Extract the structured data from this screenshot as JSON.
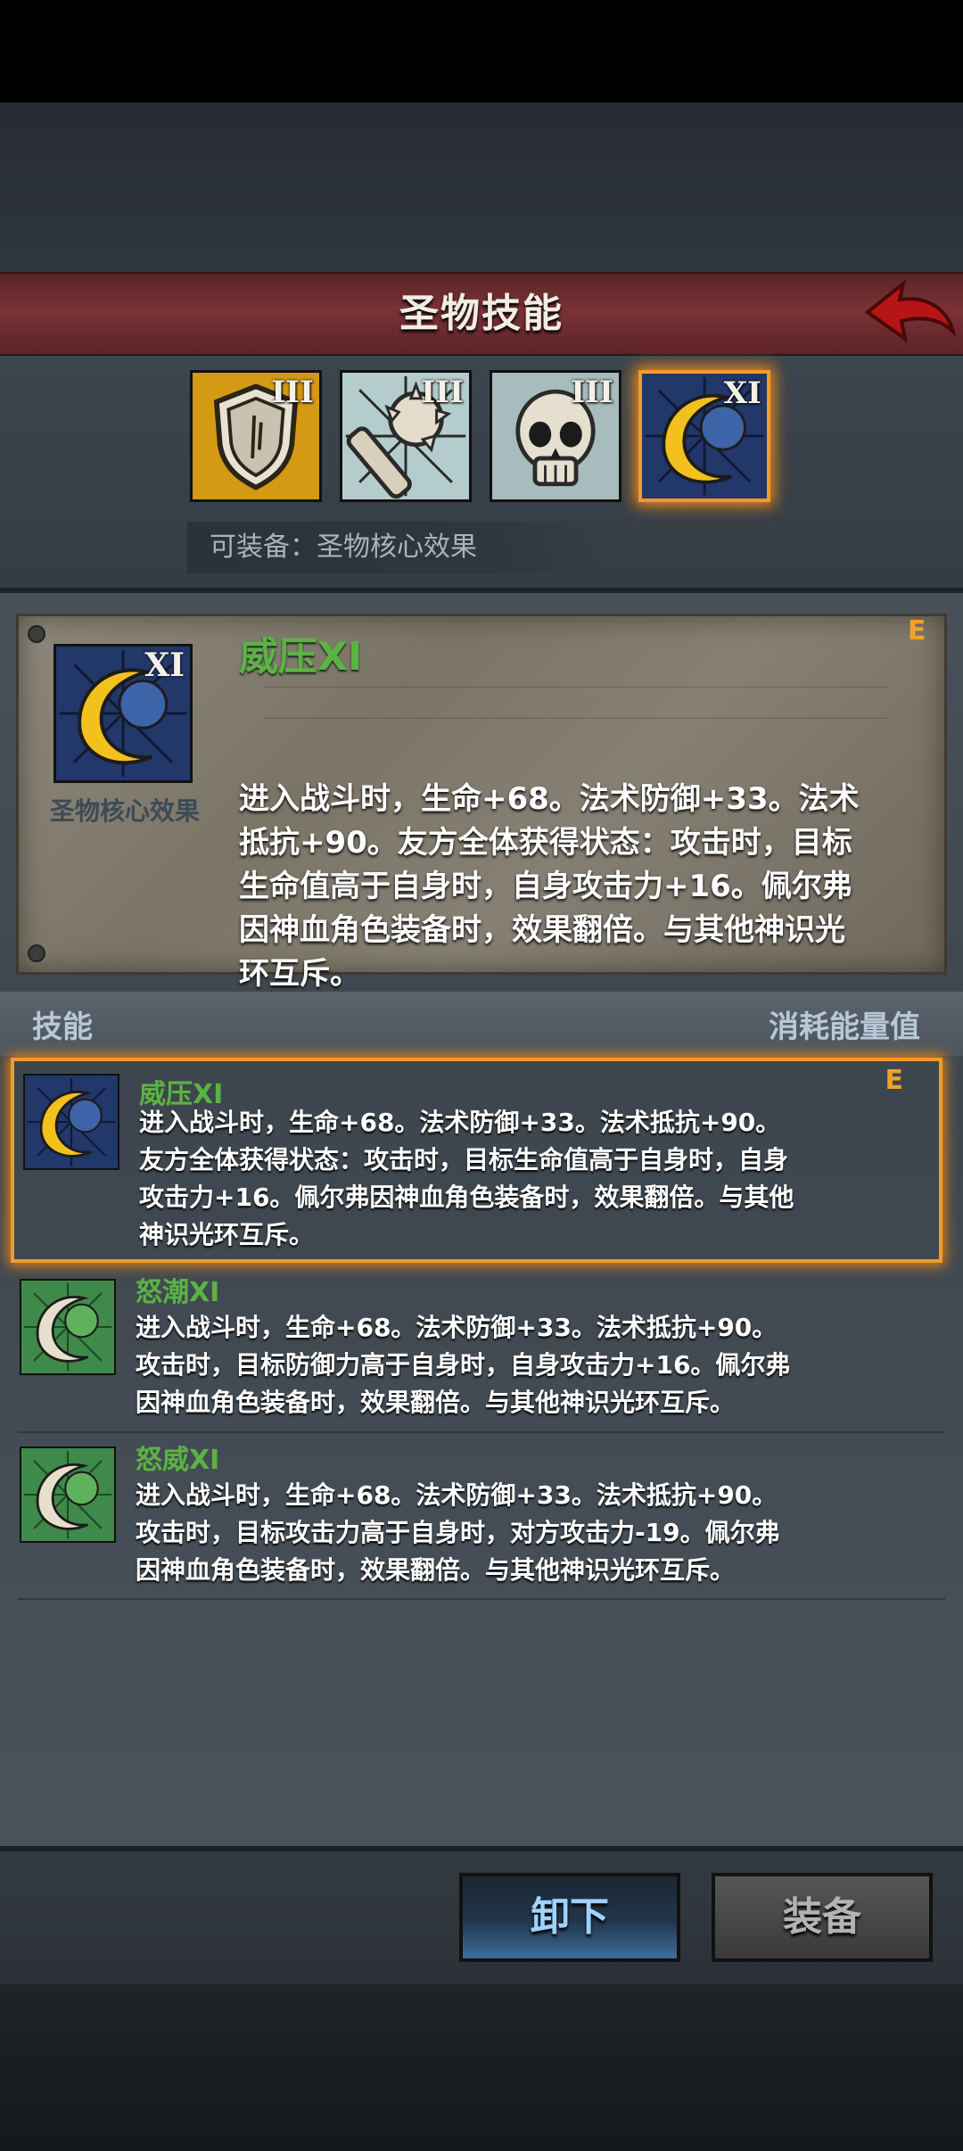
{
  "header": {
    "title": "圣物技能",
    "back_icon": "back-arrow-icon"
  },
  "relics": [
    {
      "icon": "shield-icon",
      "level": "III",
      "bg": "#d9a218"
    },
    {
      "icon": "spiked-club-icon",
      "level": "III",
      "bg": "#bcd2d2"
    },
    {
      "icon": "skull-icon",
      "level": "III",
      "bg": "#a9bcbc"
    },
    {
      "icon": "moon-icon",
      "level": "XI",
      "bg": "#23386b",
      "selected": true
    }
  ],
  "equip_hint": "可装备：圣物核心效果",
  "detail": {
    "level": "XI",
    "caption": "圣物核心效果",
    "name": "威压XI",
    "grade": "E",
    "description": "进入战斗时，生命+68。法术防御+33。法术抵抗+90。友方全体获得状态：攻击时，目标生命值高于自身时，自身攻击力+16。佩尔弗因神血角色装备时，效果翻倍。与其他神识光环互斥。"
  },
  "skills_header": {
    "left": "技能",
    "right": "消耗能量值"
  },
  "skills": [
    {
      "name": "威压XI",
      "grade": "E",
      "icon": "gold-moon-icon",
      "description": "进入战斗时，生命+68。法术防御+33。法术抵抗+90。友方全体获得状态：攻击时，目标生命值高于自身时，自身攻击力+16。佩尔弗因神血角色装备时，效果翻倍。与其他神识光环互斥。"
    },
    {
      "name": "怒潮XI",
      "grade": "",
      "icon": "green-moon-icon",
      "description": "进入战斗时，生命+68。法术防御+33。法术抵抗+90。攻击时，目标防御力高于自身时，自身攻击力+16。佩尔弗因神血角色装备时，效果翻倍。与其他神识光环互斥。"
    },
    {
      "name": "怒威XI",
      "grade": "",
      "icon": "green-moon-icon",
      "description": "进入战斗时，生命+68。法术防御+33。法术抵抗+90。攻击时，目标攻击力高于自身时，对方攻击力-19。佩尔弗因神血角色装备时，效果翻倍。与其他神识光环互斥。"
    }
  ],
  "buttons": {
    "unload": "卸下",
    "equip": "装备"
  }
}
